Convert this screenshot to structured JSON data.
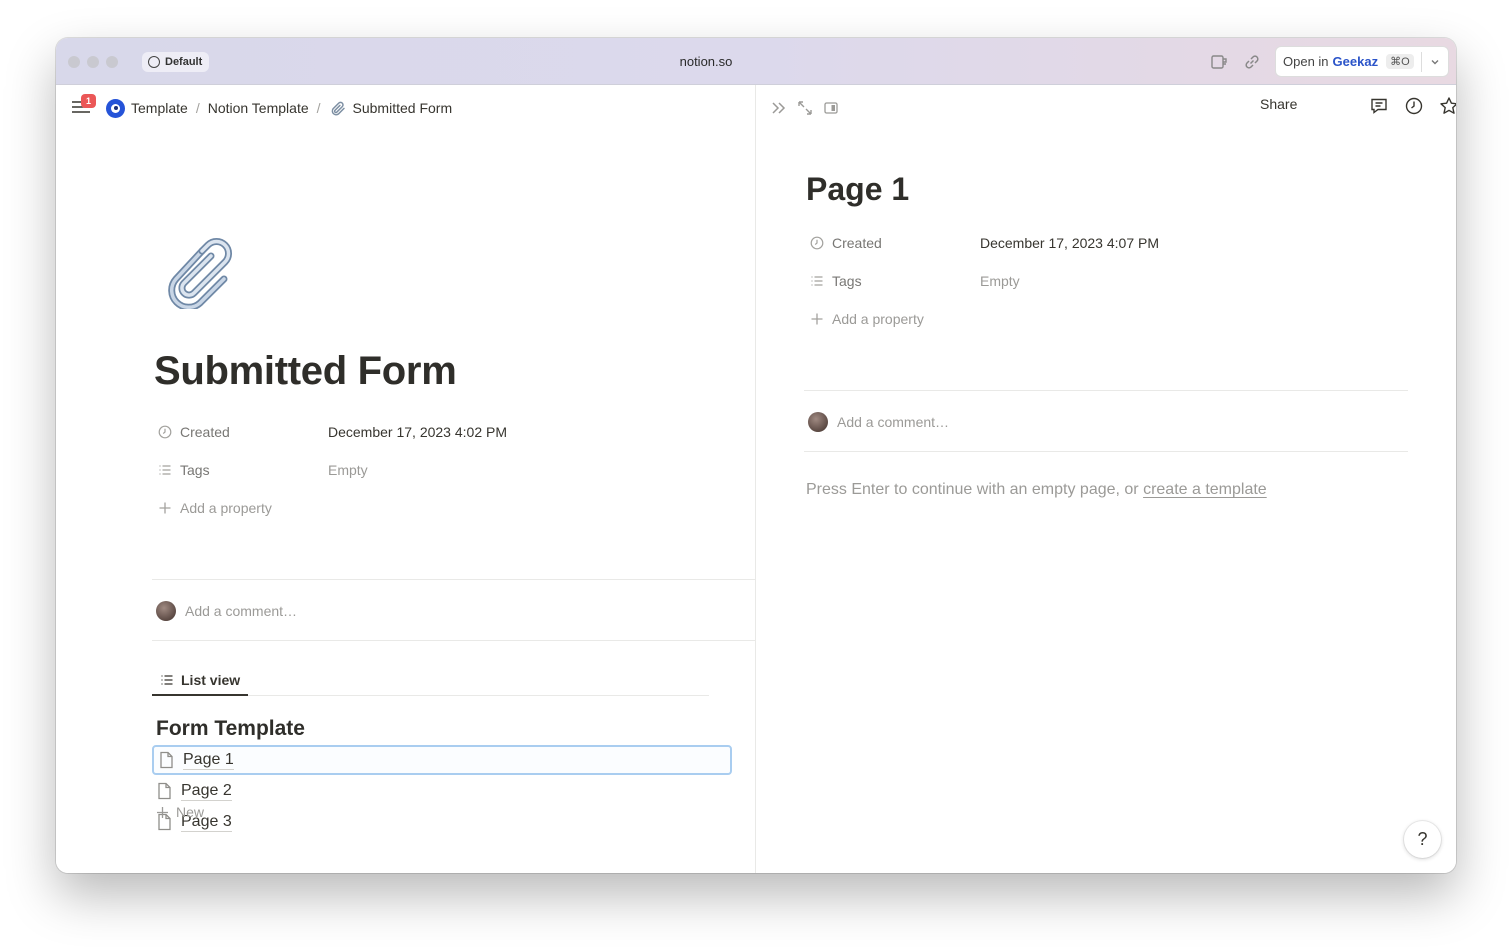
{
  "browser": {
    "profile_label": "Default",
    "url": "notion.so",
    "open_in_prefix": "Open in",
    "open_in_app": "Geekaz",
    "open_in_shortcut": "⌘O"
  },
  "sidebar_toggle": {
    "badge_count": "1"
  },
  "breadcrumb": {
    "items": [
      "Template",
      "Notion Template",
      "Submitted Form"
    ],
    "separator": "/"
  },
  "left_page": {
    "icon": "paperclip-icon",
    "title": "Submitted Form",
    "properties": [
      {
        "name": "Created",
        "value": "December 17, 2023 4:02 PM",
        "icon": "clock-icon"
      },
      {
        "name": "Tags",
        "value": "Empty",
        "icon": "list-icon"
      }
    ],
    "add_property_label": "Add a property",
    "comment_placeholder": "Add a comment…",
    "view_tab": "List view",
    "database_title": "Form Template",
    "list_items": [
      "Page 1",
      "Page 2",
      "Page 3"
    ],
    "new_label": "New"
  },
  "right_page": {
    "share_label": "Share",
    "title": "Page 1",
    "properties": [
      {
        "name": "Created",
        "value": "December 17, 2023 4:07 PM",
        "icon": "clock-icon"
      },
      {
        "name": "Tags",
        "value": "Empty",
        "icon": "list-icon"
      }
    ],
    "add_property_label": "Add a property",
    "comment_placeholder": "Add a comment…",
    "empty_hint_prefix": "Press Enter to continue with an empty page, or ",
    "empty_hint_link": "create a template",
    "help_label": "?"
  },
  "colors": {
    "accent": "#2b54c9",
    "badge": "#eb5757",
    "selection_border": "#a9cdf0",
    "text_primary": "#37352f",
    "text_muted": "#9b9a97"
  }
}
